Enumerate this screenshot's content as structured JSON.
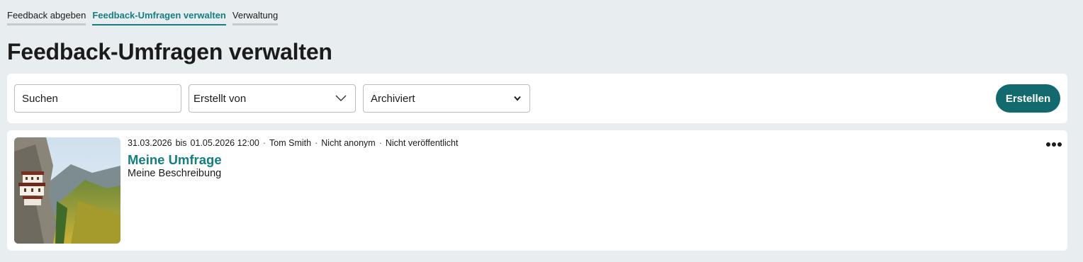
{
  "tabs": [
    {
      "label": "Feedback abgeben",
      "active": false
    },
    {
      "label": "Feedback-Umfragen verwalten",
      "active": true
    },
    {
      "label": "Verwaltung",
      "active": false
    }
  ],
  "page": {
    "title": "Feedback-Umfragen verwalten"
  },
  "filters": {
    "search_placeholder": "Suchen",
    "creator_value": "Erstellt von",
    "archived_value": "Archiviert"
  },
  "actions": {
    "create_label": "Erstellen"
  },
  "colors": {
    "accent": "#157d83",
    "button": "#126a6e",
    "background": "#e8edf0"
  },
  "surveys": [
    {
      "start": "31.03.2026",
      "until_word": "bis",
      "end": "01.05.2026 12:00",
      "author": "Tom Smith",
      "anonymity": "Nicht anonym",
      "status": "Nicht veröffentlicht",
      "title": "Meine Umfrage",
      "description": "Meine Beschreibung",
      "image": "mountain-monastery-photo",
      "menu_icon": "more-horizontal-icon"
    }
  ]
}
